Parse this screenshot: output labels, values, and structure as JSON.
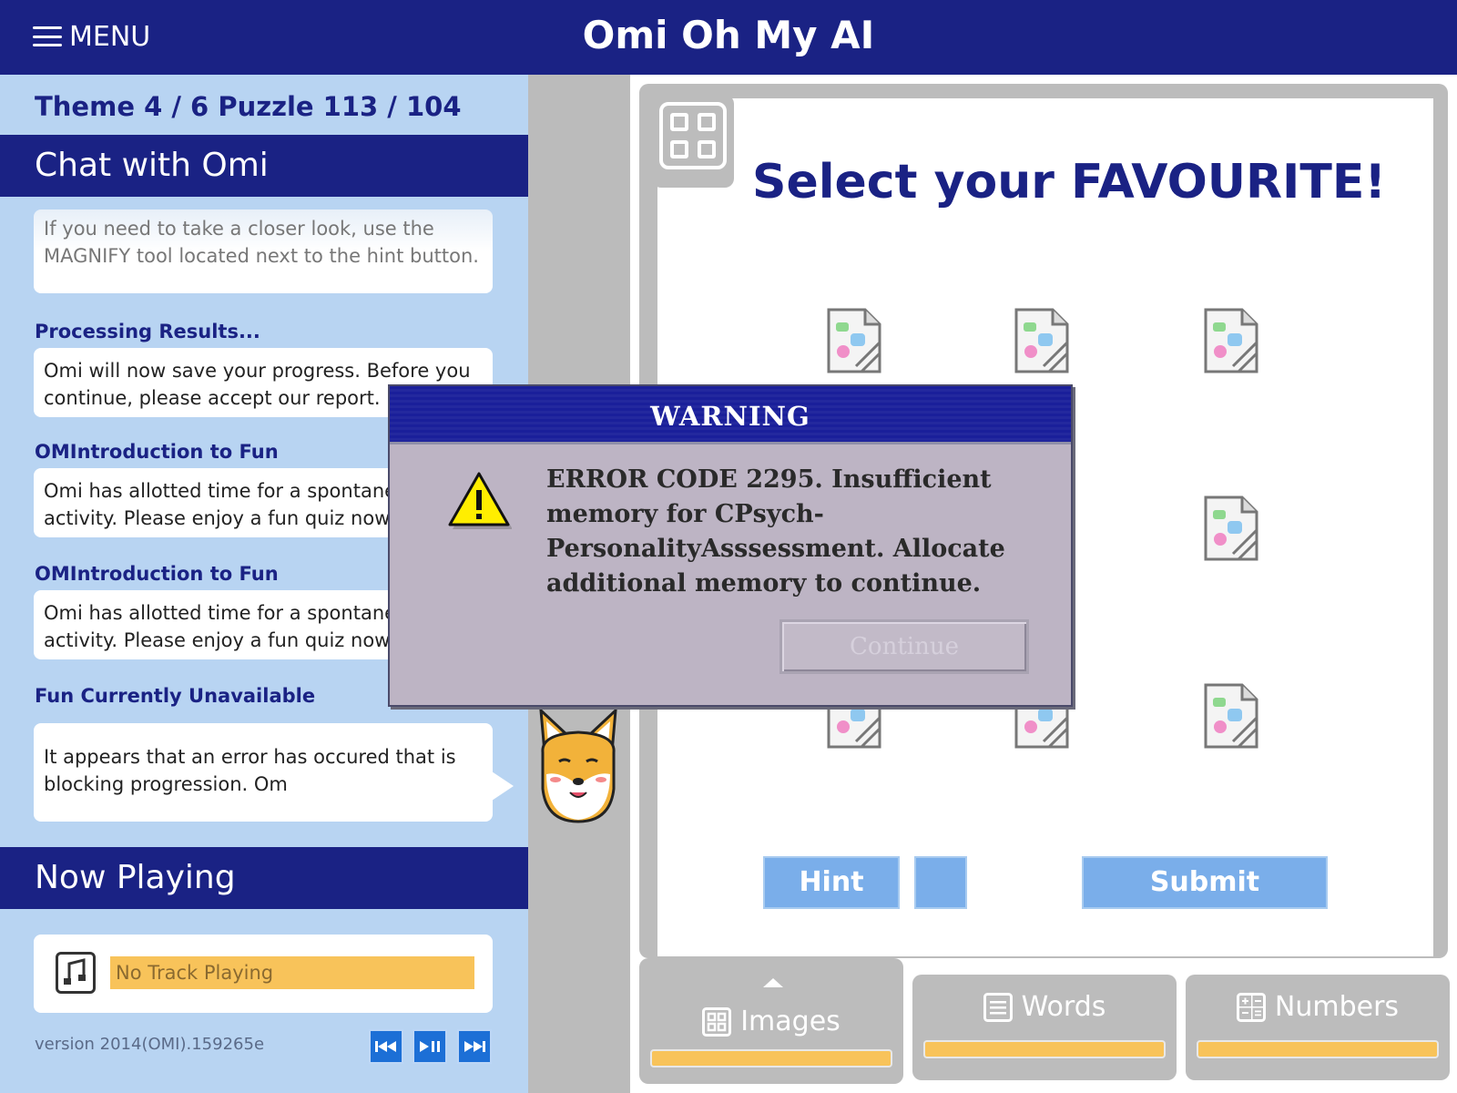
{
  "header": {
    "menu_label": "MENU",
    "app_title": "Omi Oh My AI"
  },
  "left_panel": {
    "theme_info": "Theme 4 / 6 Puzzle 113 / 104",
    "chat_title": "Chat with Omi",
    "messages": [
      {
        "title": "",
        "text": "If you need to take a closer look, use the MAGNIFY tool located next to the hint button."
      },
      {
        "title": "Processing Results...",
        "text": "Omi will now save your progress. Before you continue, please accept our report."
      },
      {
        "title": "OMIntroduction to Fun",
        "text": "Omi has allotted time for a spontaneous activity. Please enjoy a fun quiz now."
      },
      {
        "title": "OMIntroduction to Fun",
        "text": "Omi has allotted time for a spontaneous activity. Please enjoy a fun quiz now."
      },
      {
        "title": "Fun Currently Unavailable",
        "text": "It appears that an error has occured that is blocking progression. Om"
      }
    ],
    "now_playing_title": "Now Playing",
    "track": "No Track Playing",
    "version": "version 2014(OMI).159265e"
  },
  "quiz": {
    "title": "Select your FAVOURITE!",
    "hint_label": "Hint",
    "submit_label": "Submit"
  },
  "tabs": [
    {
      "label": "Images",
      "active": true
    },
    {
      "label": "Words",
      "active": false
    },
    {
      "label": "Numbers",
      "active": false
    }
  ],
  "dialog": {
    "title": "WARNING",
    "message": "ERROR CODE 2295. Insufficient memory for CPsych-PersonalityAsssessment. Allocate additional memory to continue.",
    "button_label": "Continue"
  },
  "colors": {
    "navy": "#1a2284",
    "panel_blue": "#b8d4f2",
    "button_blue": "#7aaeea",
    "accent_yellow": "#f8c35a",
    "dialog_gray": "#bdb4c4"
  }
}
